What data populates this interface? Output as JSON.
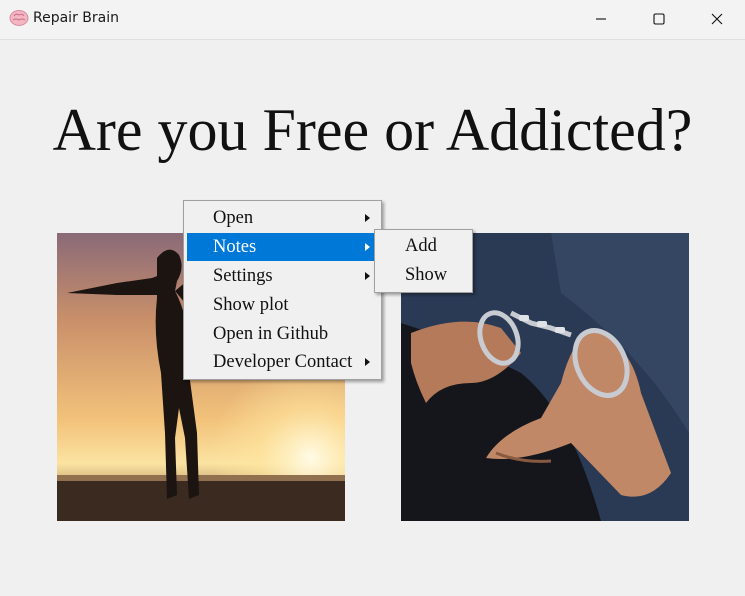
{
  "window": {
    "title": "Repair Brain",
    "controls": [
      "minimize",
      "maximize",
      "close"
    ]
  },
  "main": {
    "heading": "Are you Free or Addicted?",
    "images": [
      {
        "name": "free-silhouette-photo"
      },
      {
        "name": "handcuffed-hands-photo"
      }
    ]
  },
  "context_menu": {
    "items": [
      {
        "label": "Open",
        "has_submenu": true,
        "active": false
      },
      {
        "label": "Notes",
        "has_submenu": true,
        "active": true
      },
      {
        "label": "Settings",
        "has_submenu": true,
        "active": false
      },
      {
        "label": "Show plot",
        "has_submenu": false,
        "active": false
      },
      {
        "label": "Open in Github",
        "has_submenu": false,
        "active": false
      },
      {
        "label": "Developer Contact",
        "has_submenu": true,
        "active": false
      }
    ],
    "submenu": {
      "parent": "Notes",
      "items": [
        {
          "label": "Add"
        },
        {
          "label": "Show"
        }
      ]
    }
  },
  "colors": {
    "menu_highlight": "#0078d7",
    "background": "#f0f0f0"
  }
}
